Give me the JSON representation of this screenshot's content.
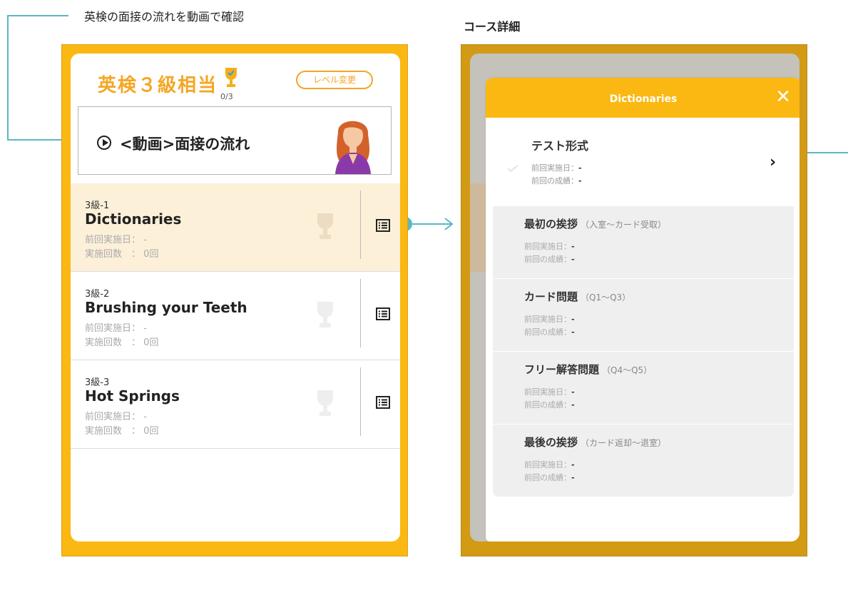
{
  "annotations": {
    "video_caption": "英検の面接の流れを動画で確認",
    "course_detail_caption": "コース詳細"
  },
  "left_screen": {
    "level_title": "英検３級相当",
    "trophy_count": "0/3",
    "level_change_button": "レベル変更",
    "video_label": "<動画>面接の流れ",
    "lessons": [
      {
        "num": "3級-1",
        "name": "Dictionaries",
        "last_date": "前回実施日：  -",
        "count": "実施回数　：  0回",
        "active": true
      },
      {
        "num": "3級-2",
        "name": "Brushing your Teeth",
        "last_date": "前回実施日：  -",
        "count": "実施回数　：  0回",
        "active": false
      },
      {
        "num": "3級-3",
        "name": "Hot Springs",
        "last_date": "前回実施日：  -",
        "count": "実施回数　：  0回",
        "active": false
      }
    ]
  },
  "right_screen": {
    "modal_title": "Dictionaries",
    "close_icon": "close-icon",
    "test": {
      "title": "テスト形式",
      "last_date_label": "前回実施日：",
      "last_date_value": "-",
      "last_score_label": "前回の成績：",
      "last_score_value": "-"
    },
    "sections": [
      {
        "title": "最初の挨拶",
        "sub": "（入室〜カード受取）",
        "last_date_label": "前回実施日：",
        "last_date_value": "-",
        "last_score_label": "前回の成績：",
        "last_score_value": "-"
      },
      {
        "title": "カード問題",
        "sub": "（Q1〜Q3）",
        "last_date_label": "前回実施日：",
        "last_date_value": "-",
        "last_score_label": "前回の成績：",
        "last_score_value": "-"
      },
      {
        "title": "フリー解答問題",
        "sub": "（Q4〜Q5）",
        "last_date_label": "前回実施日：",
        "last_date_value": "-",
        "last_score_label": "前回の成績：",
        "last_score_value": "-"
      },
      {
        "title": "最後の挨拶",
        "sub": "（カード返却〜退室）",
        "last_date_label": "前回実施日：",
        "last_date_value": "-",
        "last_score_label": "前回の成績：",
        "last_score_value": "-"
      }
    ]
  },
  "colors": {
    "accent": "#fbb812",
    "accent_text": "#f5a623",
    "annotation": "#5bb7c2",
    "active_row": "#fdf0d9"
  }
}
